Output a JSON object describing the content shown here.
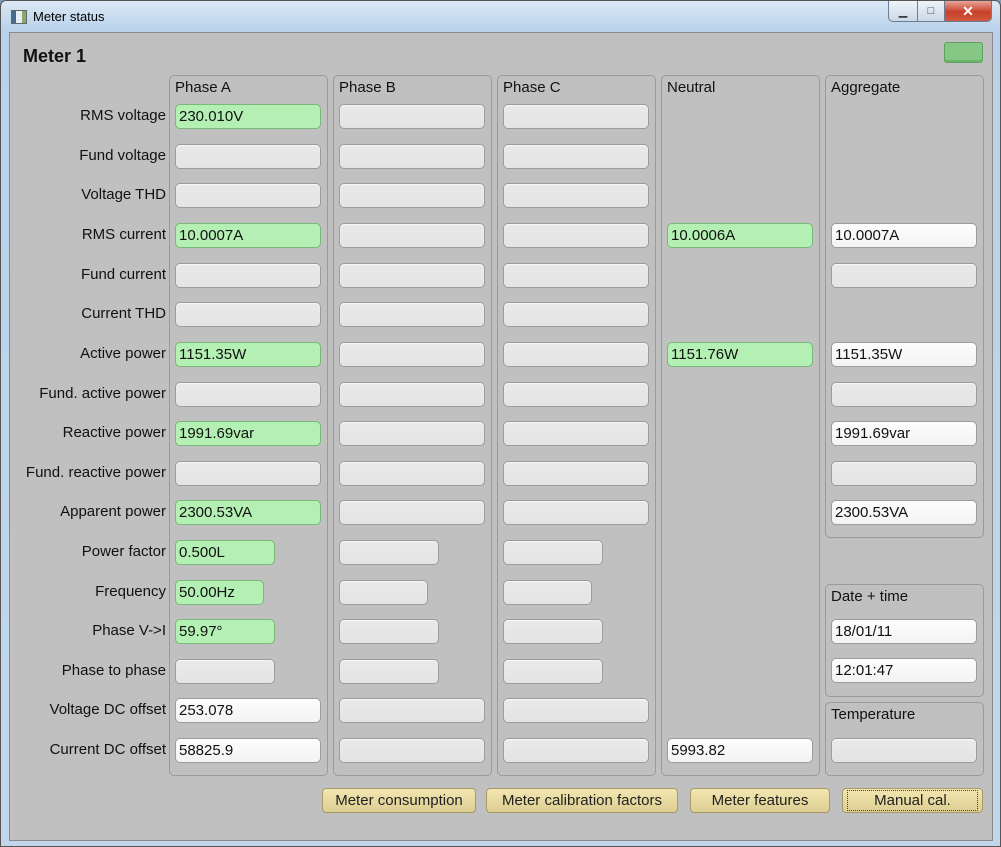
{
  "window": {
    "title": "Meter status",
    "controls": {
      "minimize": "minimize-icon",
      "maximize": "maximize-icon",
      "close": "close-icon"
    }
  },
  "meter": {
    "title": "Meter 1",
    "status_led_color": "#86c786"
  },
  "colors": {
    "green_field": "#b4f0b4",
    "button": "#e8daa0",
    "panel": "#c0c0c0"
  },
  "rows": [
    "RMS voltage",
    "Fund voltage",
    "Voltage THD",
    "RMS current",
    "Fund current",
    "Current THD",
    "Active power",
    "Fund. active power",
    "Reactive power",
    "Fund. reactive power",
    "Apparent power",
    "Power factor",
    "Frequency",
    "Phase V->I",
    "Phase to phase",
    "Voltage DC offset",
    "Current DC offset"
  ],
  "groups": {
    "phase_a": {
      "title": "Phase A",
      "values": [
        "230.010V",
        "",
        "",
        "10.0007A",
        "",
        "",
        "1151.35W",
        "",
        "1991.69var",
        "",
        "2300.53VA",
        "0.500L",
        "50.00Hz",
        "59.97°",
        "",
        "253.078",
        "58825.9"
      ]
    },
    "phase_b": {
      "title": "Phase B"
    },
    "phase_c": {
      "title": "Phase C"
    },
    "neutral": {
      "title": "Neutral",
      "rms_current": "10.0006A",
      "active_power": "1151.76W",
      "current_dc_offset": "5993.82"
    },
    "aggregate": {
      "title": "Aggregate",
      "rms_current": "10.0007A",
      "fund_current": "",
      "active_power": "1151.35W",
      "fund_active_power": "",
      "reactive_power": "1991.69var",
      "fund_reactive_power": "",
      "apparent_power": "2300.53VA"
    },
    "date_time": {
      "title": "Date + time",
      "date": "18/01/11",
      "time": "12:01:47"
    },
    "temperature": {
      "title": "Temperature",
      "value": ""
    }
  },
  "buttons": {
    "consumption": "Meter consumption",
    "calibration_factors": "Meter calibration factors",
    "features": "Meter features",
    "manual_cal": "Manual cal."
  }
}
